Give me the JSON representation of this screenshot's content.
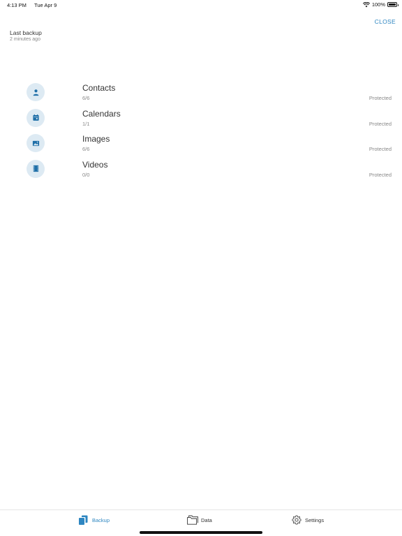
{
  "status_bar": {
    "time": "4:13 PM",
    "date": "Tue Apr 9",
    "battery_percent": "100%",
    "battery_level": 1.0
  },
  "header": {
    "close_label": "CLOSE",
    "last_backup_label": "Last backup",
    "last_backup_time": "2 minutes ago"
  },
  "items": [
    {
      "name": "Contacts",
      "count": "6/6",
      "status": "Protected",
      "icon": "person-icon"
    },
    {
      "name": "Calendars",
      "count": "1/1",
      "status": "Protected",
      "icon": "calendar-icon"
    },
    {
      "name": "Images",
      "count": "6/6",
      "status": "Protected",
      "icon": "image-icon"
    },
    {
      "name": "Videos",
      "count": "0/0",
      "status": "Protected",
      "icon": "film-icon"
    }
  ],
  "tabs": [
    {
      "label": "Backup",
      "icon": "backup-icon",
      "active": true
    },
    {
      "label": "Data",
      "icon": "folder-icon",
      "active": false
    },
    {
      "label": "Settings",
      "icon": "gear-icon",
      "active": false
    }
  ],
  "colors": {
    "accent": "#2e86c1",
    "icon_bg": "#ddeaf3",
    "icon_fg": "#1f6fa8",
    "muted_text": "#888888"
  }
}
